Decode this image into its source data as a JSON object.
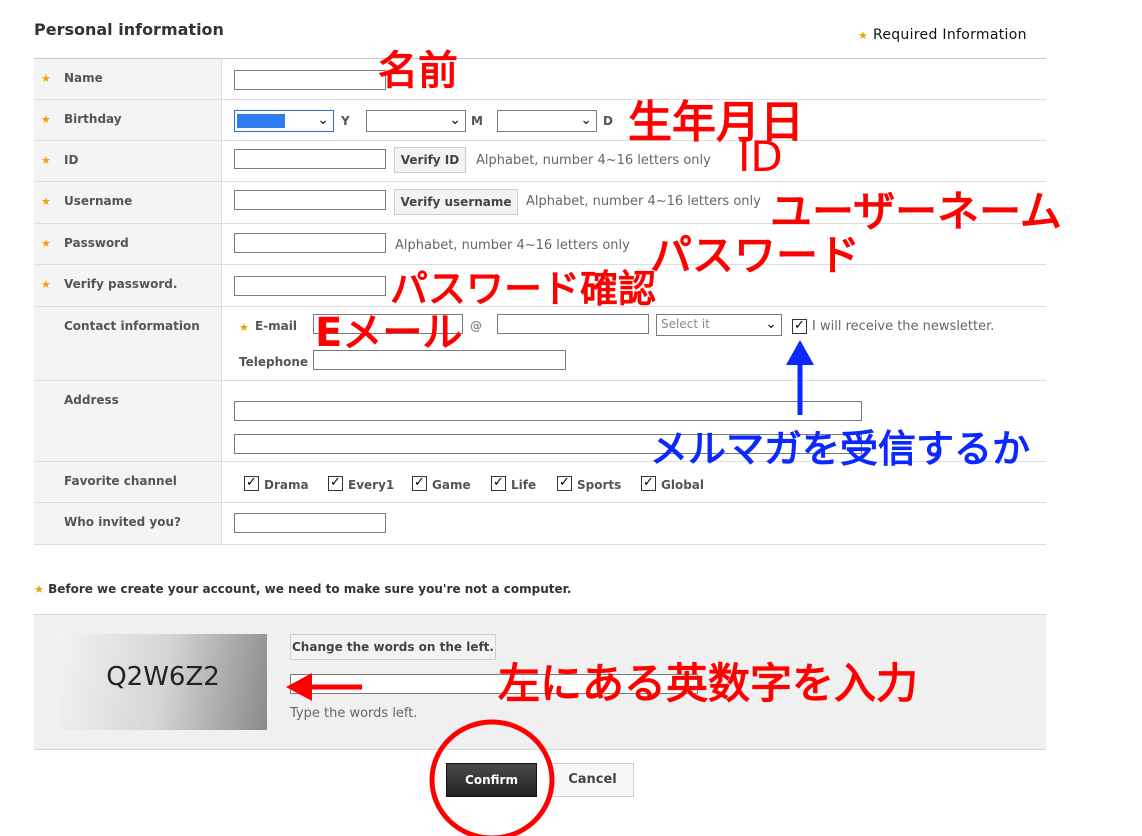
{
  "header": {
    "title": "Personal information",
    "required_info": "Required Information"
  },
  "fields": {
    "name": {
      "label": "Name"
    },
    "birthday": {
      "label": "Birthday",
      "year_unit": "Y",
      "month_unit": "M",
      "day_unit": "D"
    },
    "id": {
      "label": "ID",
      "verify_label": "Verify ID",
      "hint": "Alphabet, number 4~16 letters only"
    },
    "username": {
      "label": "Username",
      "verify_label": "Verify username",
      "hint": "Alphabet, number 4~16 letters only"
    },
    "password": {
      "label": "Password",
      "hint": "Alphabet, number 4~16 letters only"
    },
    "verify_password": {
      "label": "Verify password."
    },
    "contact": {
      "label": "Contact information",
      "email_label": "E-mail",
      "at_sign": "@",
      "domain_select": "Select it",
      "newsletter_label": "I will receive the newsletter.",
      "newsletter_checked": true,
      "telephone_label": "Telephone"
    },
    "address": {
      "label": "Address"
    },
    "favorite_channel": {
      "label": "Favorite channel",
      "options": [
        {
          "label": "Drama",
          "checked": true
        },
        {
          "label": "Every1",
          "checked": true
        },
        {
          "label": "Game",
          "checked": true
        },
        {
          "label": "Life",
          "checked": true
        },
        {
          "label": "Sports",
          "checked": true
        },
        {
          "label": "Global",
          "checked": true
        }
      ]
    },
    "invited": {
      "label": "Who invited you?"
    }
  },
  "captcha": {
    "notice": "Before we create your account, we need to make sure you're not a computer.",
    "code": "Q2W6Z2",
    "change_label": "Change the words on the left.",
    "hint": "Type the words left."
  },
  "actions": {
    "confirm": "Confirm",
    "cancel": "Cancel"
  },
  "annotations": {
    "name": "名前",
    "birthday": "生年月日",
    "id": "ID",
    "username": "ユーザーネーム",
    "password": "パスワード",
    "verify_password": "パスワード確認",
    "email": "Eメール",
    "newsletter": "メルマガを受信するか",
    "captcha": "左にある英数字を入力"
  },
  "colors": {
    "annotation_red": "#ff0000",
    "annotation_blue": "#0a28ff",
    "required_star": "#f0a000"
  }
}
